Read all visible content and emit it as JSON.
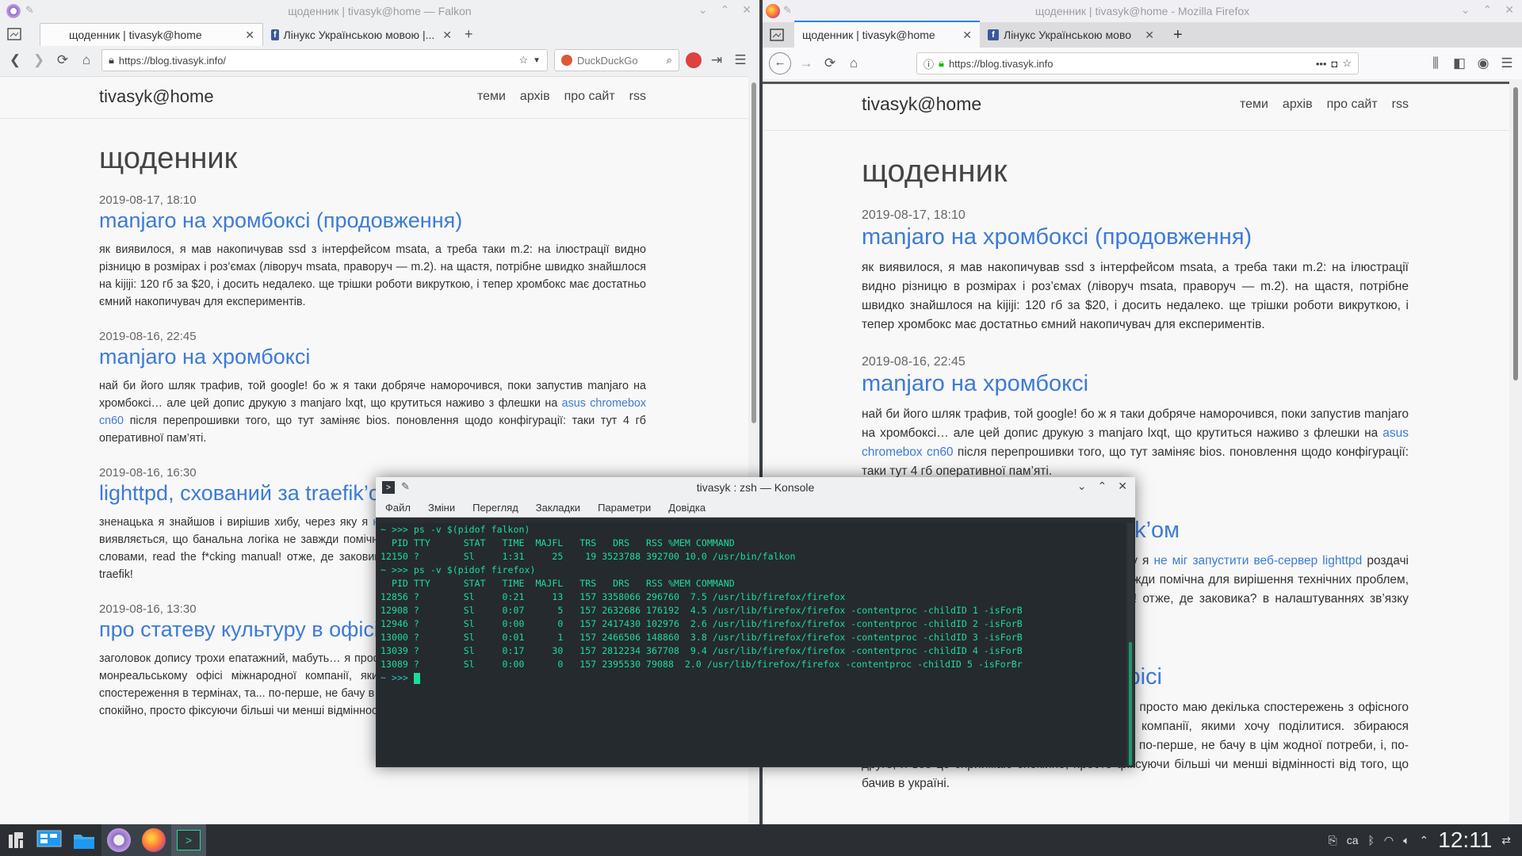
{
  "falkon": {
    "window_title": "щоденник | tivasyk@home — Falkon",
    "tabs": [
      {
        "label": "щоденник | tivasyk@home",
        "active": true
      },
      {
        "label": "Лінукс Українською мовою |...",
        "active": false
      }
    ],
    "url": "https://blog.tivasyk.info/",
    "search_engine": "DuckDuckGo"
  },
  "firefox": {
    "window_title": "щоденник | tivasyk@home - Mozilla Firefox",
    "tabs": [
      {
        "label": "щоденник | tivasyk@home",
        "active": true
      },
      {
        "label": "Лінукс Українською мово",
        "active": false
      }
    ],
    "url": "https://blog.tivasyk.info"
  },
  "blog": {
    "site_name": "tivasyk@home",
    "nav": [
      "теми",
      "архів",
      "про сайт",
      "rss"
    ],
    "page_title": "щоденник",
    "posts": [
      {
        "date": "2019-08-17, 18:10",
        "title": "manjaro на хромбоксі (продовження)",
        "body": "як виявилося, я мав накопичував ssd з інтерфейсом msata, а треба таки m.2: на ілюстрації видно різницю в розмірах і роз’ємах (ліворуч msata, праворуч — m.2). на щастя, потрібне швидко знайшлося на kijiji: 120 гб за $20, і досить недалеко. ще трішки роботи викруткою, і тепер хромбокс має достатньо ємний накопичувач для експериментів."
      },
      {
        "date": "2019-08-16, 22:45",
        "title": "manjaro на хромбоксі",
        "body_pre": "най би його шляк трафив, той google! бо ж я таки добряче наморочився, поки запустив manjaro на хромбоксі… але цей допис друкую з manjaro lxqt, що крутиться наживо з флешки на ",
        "body_link": "asus chromebox cn60",
        "body_post": " після перепрошивки того, що тут заміняє bios. поновлення щодо конфігурації: таки тут 4 гб оперативної пам’яті."
      },
      {
        "date": "2019-08-16, 16:30",
        "title": "lighttpd, схований за traefik’ом",
        "body_pre": "зненацька я знайшов і вирішив хибу, через яку я ",
        "body_link": "не міг запустити веб-сервер lighttpd",
        "body_post": " роздачі блогу. виявляється, що банальна логіка не завжди помічна для вирішення технічних проблем, або, іншими словами, read the f*cking manual! отже, де заковика? в налаштуваннях зв’язку контейнера з проксі traefik!"
      },
      {
        "date": "2019-08-16, 13:30",
        "title": "про статеву культуру в офісі",
        "body": "заголовок допису трохи епатажний, мабуть… я просто маю декілька спостережень з офісного життя в монреальському офісі міжнародної компанії, якими хочу поділитися. збираюся коментувати ці спостереження в термінах, та... по-перше, не бачу в цім жодної потреби, і, по-друге, я все це сприймаю спокійно, просто фіксуючи більші чи менші відмінності від того, що бачив в україні."
      }
    ]
  },
  "konsole": {
    "title": "tivasyk : zsh — Konsole",
    "menu": [
      "Файл",
      "Зміни",
      "Перегляд",
      "Закладки",
      "Параметри",
      "Довідка"
    ],
    "lines": [
      "~ >>> ps -v $(pidof falkon)",
      "  PID TTY      STAT   TIME  MAJFL   TRS   DRS   RSS %MEM COMMAND",
      "12150 ?        Sl     1:31     25    19 3523788 392700 10.0 /usr/bin/falkon",
      "~ >>> ps -v $(pidof firefox)",
      "  PID TTY      STAT   TIME  MAJFL   TRS   DRS   RSS %MEM COMMAND",
      "12856 ?        Sl     0:21     13   157 3358066 296760  7.5 /usr/lib/firefox/firefox",
      "12908 ?        Sl     0:07      5   157 2632686 176192  4.5 /usr/lib/firefox/firefox -contentproc -childID 1 -isForB",
      "12946 ?        Sl     0:00      0   157 2417430 102976  2.6 /usr/lib/firefox/firefox -contentproc -childID 2 -isForB",
      "13000 ?        Sl     0:01      1   157 2466506 148860  3.8 /usr/lib/firefox/firefox -contentproc -childID 3 -isForB",
      "13039 ?        Sl     0:17     30   157 2812234 367708  9.4 /usr/lib/firefox/firefox -contentproc -childID 4 -isForB",
      "13089 ?        Sl     0:00      0   157 2395530 79088  2.0 /usr/lib/firefox/firefox -contentproc -childID 5 -isForBr"
    ],
    "prompt": "~ >>> "
  },
  "taskbar": {
    "clock": "12:11",
    "keyboard_layout": "ca"
  },
  "colors": {
    "link": "#3d7bd6",
    "terminal_text": "#1cdc9a",
    "taskbar": "#2b2f33"
  }
}
